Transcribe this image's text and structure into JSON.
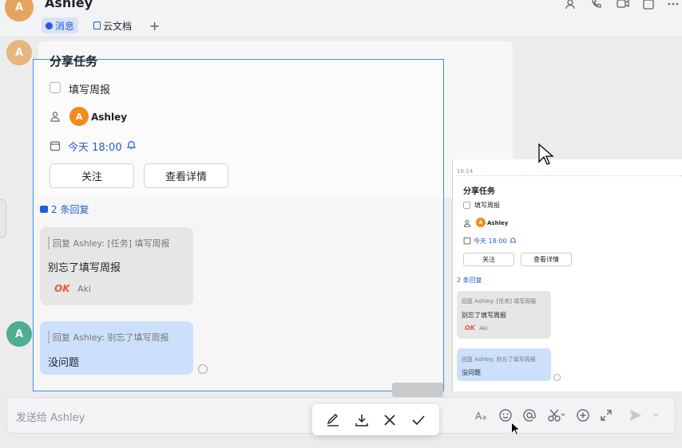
{
  "header": {
    "avatar_letter": "A",
    "name": "Ashley",
    "tabs": [
      {
        "label": "消息",
        "active": true
      },
      {
        "label": "云文档",
        "active": false
      }
    ],
    "add_tab": "+"
  },
  "task_card": {
    "title": "分享任务",
    "task_name": "填写周报",
    "owner_letter": "A",
    "owner_name": "Ashley",
    "due": "今天 18:00",
    "follow_button": "关注",
    "detail_button": "查看详情"
  },
  "thread": {
    "replies": "2 条回复",
    "messages": [
      {
        "quote": "回复 Ashley: [任务] 填写周报",
        "text": "别忘了填写周报",
        "reaction": "OK",
        "reaction_user": "Aki"
      },
      {
        "quote": "回复 Ashley: 别忘了填写周报",
        "text": "没问题"
      }
    ]
  },
  "preview": {
    "time": "16:14",
    "title": "分享任务",
    "task_name": "填写周报",
    "owner_letter": "A",
    "owner_name": "Ashley",
    "due": "今天 18:00",
    "follow_button": "关注",
    "detail_button": "查看详情",
    "replies": "2 条回复",
    "quote1": "回复 Ashley: [任务] 填写周报",
    "msg1": "别忘了填写周报",
    "reaction": "OK",
    "reaction_user": "Aki",
    "quote2": "回复 Ashley: 别忘了填写周报",
    "msg2": "没问题"
  },
  "input": {
    "placeholder": "发送给 Ashley"
  },
  "second_avatar_letter": "A",
  "colors": {
    "accent": "#245bdb",
    "selection": "#3b8ff0",
    "owner_avatar": "#f08c1d",
    "reply_bubble": "#cde0fb"
  }
}
